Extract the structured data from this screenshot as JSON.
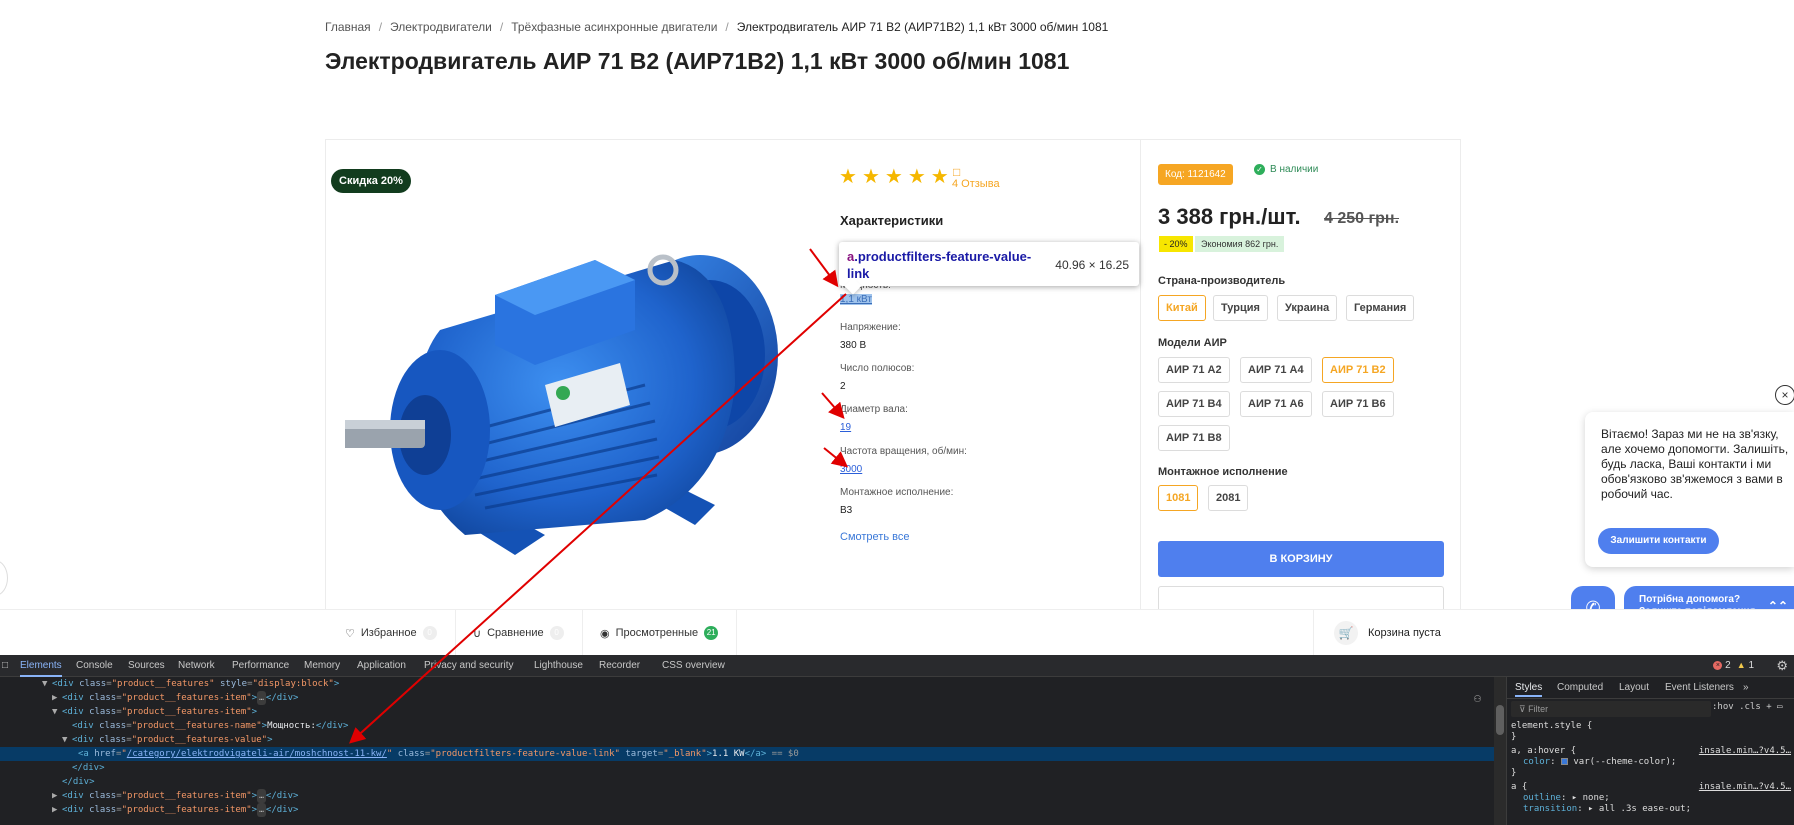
{
  "breadcrumb": {
    "items": [
      "Главная",
      "Электродвигатели",
      "Трёхфазные асинхронные двигатели"
    ],
    "separator": "/",
    "current": "Электродвигатель АИР 71 В2 (АИР71В2) 1,1 кВт 3000 об/мин 1081"
  },
  "product": {
    "title": "Электродвигатель АИР 71 В2 (АИР71В2) 1,1 кВт 3000 об/мин 1081",
    "discount_badge": "Скидка 20%",
    "image_alt": "blue-electric-motor",
    "rating_stars": 5,
    "reviews_label": "4 Отзыва",
    "features_title": "Характеристики",
    "features": [
      {
        "name": "Мощность:",
        "value": "1,1 кВт",
        "link": true,
        "highlighted": true
      },
      {
        "name": "Напряжение:",
        "value": "380 В",
        "link": false
      },
      {
        "name": "Число полюсов:",
        "value": "2",
        "link": false
      },
      {
        "name": "Диаметр вала:",
        "value": "19",
        "link": true
      },
      {
        "name": "Частота вращения, об/мин:",
        "value": "3000",
        "link": true
      },
      {
        "name": "Монтажное исполнение:",
        "value": "В3",
        "link": false
      }
    ],
    "see_all": "Смотреть все"
  },
  "tooltip": {
    "tag": "a",
    "selector": ".productfilters-feature-value-link",
    "size": "40.96 × 16.25"
  },
  "buybox": {
    "sku": "Код: 1121642",
    "stock": "В наличии",
    "price": "3 388 грн./шт.",
    "old_price": "4 250 грн.",
    "discount_pct": "- 20%",
    "economy": "Экономия 862 грн.",
    "country_label": "Страна-производитель",
    "countries": [
      {
        "label": "Китай",
        "active": true
      },
      {
        "label": "Турция",
        "active": false
      },
      {
        "label": "Украина",
        "active": false
      },
      {
        "label": "Германия",
        "active": false
      }
    ],
    "models_label": "Модели АИР",
    "models": [
      {
        "label": "АИР 71 А2",
        "active": false
      },
      {
        "label": "АИР 71 А4",
        "active": false
      },
      {
        "label": "АИР 71 В2",
        "active": true
      },
      {
        "label": "АИР 71 В4",
        "active": false
      },
      {
        "label": "АИР 71 А6",
        "active": false
      },
      {
        "label": "АИР 71 В6",
        "active": false
      },
      {
        "label": "АИР 71 В8",
        "active": false
      }
    ],
    "mount_label": "Монтажное исполнение",
    "mounts": [
      {
        "label": "1081",
        "active": true
      },
      {
        "label": "2081",
        "active": false
      }
    ],
    "cart_button": "В КОРЗИНУ"
  },
  "chat": {
    "close_icon": "×",
    "message": "Вітаємо! Зараз ми не на зв'язку, але хочемо допомогти. Залишіть, будь ласка, Ваші контакти і ми обов'язково зв'яжемося з вами в робочий час.",
    "contact_button": "Залишити контакти",
    "help_line1": "Потрібна допомога?",
    "help_line2": "Залиште повідомлення",
    "phone_icon": "phone-icon"
  },
  "bottom_bar": {
    "favorites": {
      "label": "Избранное",
      "count": "0"
    },
    "compare": {
      "label": "Сравнение",
      "count": "0"
    },
    "viewed": {
      "label": "Просмотренные",
      "count": "21"
    },
    "cart": {
      "label": "Корзина пуста"
    }
  },
  "devtools": {
    "tabs": [
      "Elements",
      "Console",
      "Sources",
      "Network",
      "Performance",
      "Memory",
      "Application",
      "Privacy and security",
      "Lighthouse",
      "Recorder",
      "CSS overview"
    ],
    "active_tab": "Elements",
    "errors": "2",
    "warnings": "1",
    "dom_lines": {
      "l1_attr_class": "product__features",
      "l1_attr_style": "display:block",
      "item_class": "product__features-item",
      "name_class": "product__features-name",
      "name_text": "Мощность:",
      "value_class": "product__features-value",
      "href": "/category/elektrodvigateli-air/moshchnost-11-kw/",
      "link_class": "productfilters-feature-value-link",
      "target": "_blank",
      "link_text": "1.1 KW",
      "selected_suffix": "== $0"
    },
    "styles_tabs": [
      "Styles",
      "Computed",
      "Layout",
      "Event Listeners"
    ],
    "styles_active": "Styles",
    "filter_placeholder": "Filter",
    "hov_cls": ":hov .cls",
    "rules": [
      {
        "selector": "element.style {",
        "source": ""
      },
      {
        "selector": "a, a:hover {",
        "source": "insale.min…?v4.5…",
        "prop": "color",
        "value": "var(--cheme-color);"
      },
      {
        "selector": "a {",
        "source": "insale.min…?v4.5…",
        "prop": "outline",
        "value": "none;"
      },
      {
        "prop2": "transition",
        "value2": "all .3s ease-out;"
      }
    ]
  }
}
